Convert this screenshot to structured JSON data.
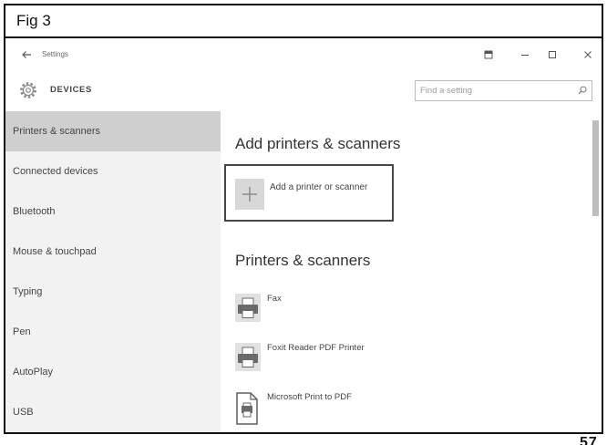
{
  "figure": {
    "label": "Fig 3",
    "page_number": "57"
  },
  "window": {
    "title": "Settings",
    "icons": {
      "back": "back-arrow-icon",
      "mode": "app-mode-icon",
      "minimize": "minimize-icon",
      "maximize": "maximize-icon",
      "close": "close-icon"
    }
  },
  "header": {
    "icon": "gear-icon",
    "section_title": "DEVICES",
    "search_placeholder": "Find a setting",
    "search_icon": "search-icon"
  },
  "sidebar": {
    "items": [
      {
        "label": "Printers & scanners",
        "selected": true
      },
      {
        "label": "Connected devices",
        "selected": false
      },
      {
        "label": "Bluetooth",
        "selected": false
      },
      {
        "label": "Mouse & touchpad",
        "selected": false
      },
      {
        "label": "Typing",
        "selected": false
      },
      {
        "label": "Pen",
        "selected": false
      },
      {
        "label": "AutoPlay",
        "selected": false
      },
      {
        "label": "USB",
        "selected": false
      }
    ]
  },
  "main": {
    "add_section": {
      "heading": "Add printers & scanners",
      "button_label": "Add a printer or scanner",
      "button_icon": "plus-icon"
    },
    "devices_section": {
      "heading": "Printers & scanners",
      "devices": [
        {
          "name": "Fax",
          "icon": "printer-icon"
        },
        {
          "name": "Foxit Reader PDF Printer",
          "icon": "printer-icon"
        },
        {
          "name": "Microsoft Print to PDF",
          "icon": "pdf-document-icon"
        }
      ]
    }
  },
  "colors": {
    "sidebar_bg": "#f2f2f2",
    "selected_bg": "#cfcfcf",
    "text": "#404040",
    "scrollbar": "#bdbdbd"
  }
}
